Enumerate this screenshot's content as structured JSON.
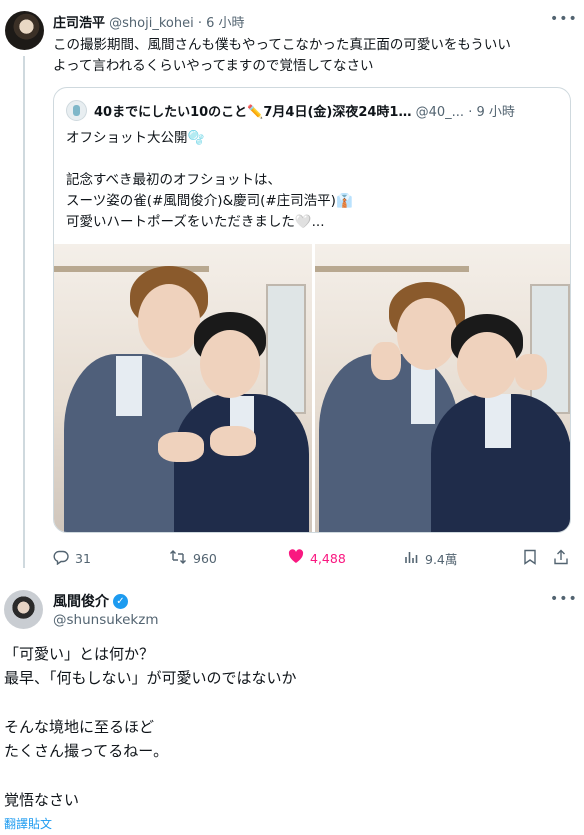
{
  "tweet1": {
    "name": "庄司浩平",
    "handle": "@shoji_kohei",
    "separator": "·",
    "time": "6 小時",
    "text": "この撮影期間、風間さんも僕もやってこなかった真正面の可愛いをもういい\nよって言われるくらいやってますので覚悟してなさい",
    "quote": {
      "name": "40までにしたい10のこと✏️7月4日(金)深夜24時1…",
      "handle": "@40_...",
      "separator": "·",
      "time": "9 小時",
      "text": "オフショット大公開🫧\n\n記念すべき最初のオフショットは、\nスーツ姿の雀(#風間俊介)&慶司(#庄司浩平)👔\n可愛いハートポーズをいただきました🤍..."
    },
    "actions": {
      "replies": "31",
      "retweets": "960",
      "likes": "4,488",
      "views": "9.4萬"
    },
    "colors": {
      "like": "#f91880",
      "muted": "#536471"
    }
  },
  "tweet2": {
    "name": "風間俊介",
    "handle": "@shunsukekzm",
    "text": "「可愛い」とは何か？\n最早、「何もしない」が可愛いのではないか\n\nそんな境地に至るほど\nたくさん撮ってるねー。\n\n覚悟なさい",
    "translate_link": "翻譯貼文",
    "colors": {
      "verified": "#1d9bf0",
      "link": "#1d9bf0"
    }
  },
  "icons": [
    "reply-icon",
    "retweet-icon",
    "like-icon",
    "views-icon",
    "bookmark-icon",
    "share-icon",
    "more-icon",
    "verified-badge-icon"
  ]
}
